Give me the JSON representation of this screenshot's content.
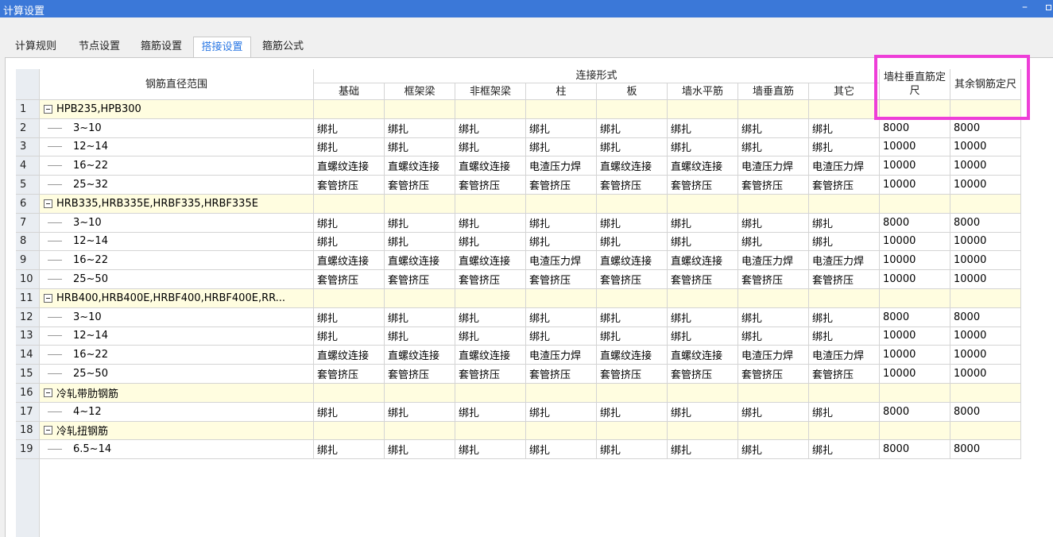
{
  "window": {
    "title": "计算设置",
    "minimize_label": "–"
  },
  "tabs": [
    {
      "label": "计算规则",
      "active": false
    },
    {
      "label": "节点设置",
      "active": false
    },
    {
      "label": "箍筋设置",
      "active": false
    },
    {
      "label": "搭接设置",
      "active": true
    },
    {
      "label": "箍筋公式",
      "active": false
    }
  ],
  "header": {
    "range": "钢筋直径范围",
    "connection_group": "连接形式",
    "connection_cols": [
      "基础",
      "框架梁",
      "非框架梁",
      "柱",
      "板",
      "墙水平筋",
      "墙垂直筋",
      "其它"
    ],
    "wall_col": "墙柱垂直筋定尺",
    "other_col": "其余钢筋定尺"
  },
  "rows": [
    {
      "n": "1",
      "group": true,
      "range": "HPB235,HPB300",
      "c": [],
      "wall": "",
      "other": ""
    },
    {
      "n": "2",
      "group": false,
      "range": "3~10",
      "c": [
        "绑扎",
        "绑扎",
        "绑扎",
        "绑扎",
        "绑扎",
        "绑扎",
        "绑扎",
        "绑扎"
      ],
      "wall": "8000",
      "other": "8000"
    },
    {
      "n": "3",
      "group": false,
      "range": "12~14",
      "c": [
        "绑扎",
        "绑扎",
        "绑扎",
        "绑扎",
        "绑扎",
        "绑扎",
        "绑扎",
        "绑扎"
      ],
      "wall": "10000",
      "other": "10000"
    },
    {
      "n": "4",
      "group": false,
      "range": "16~22",
      "c": [
        "直螺纹连接",
        "直螺纹连接",
        "直螺纹连接",
        "电渣压力焊",
        "直螺纹连接",
        "直螺纹连接",
        "电渣压力焊",
        "电渣压力焊"
      ],
      "wall": "10000",
      "other": "10000"
    },
    {
      "n": "5",
      "group": false,
      "range": "25~32",
      "c": [
        "套管挤压",
        "套管挤压",
        "套管挤压",
        "套管挤压",
        "套管挤压",
        "套管挤压",
        "套管挤压",
        "套管挤压"
      ],
      "wall": "10000",
      "other": "10000"
    },
    {
      "n": "6",
      "group": true,
      "range": "HRB335,HRB335E,HRBF335,HRBF335E",
      "c": [],
      "wall": "",
      "other": ""
    },
    {
      "n": "7",
      "group": false,
      "range": "3~10",
      "c": [
        "绑扎",
        "绑扎",
        "绑扎",
        "绑扎",
        "绑扎",
        "绑扎",
        "绑扎",
        "绑扎"
      ],
      "wall": "8000",
      "other": "8000"
    },
    {
      "n": "8",
      "group": false,
      "range": "12~14",
      "c": [
        "绑扎",
        "绑扎",
        "绑扎",
        "绑扎",
        "绑扎",
        "绑扎",
        "绑扎",
        "绑扎"
      ],
      "wall": "10000",
      "other": "10000"
    },
    {
      "n": "9",
      "group": false,
      "range": "16~22",
      "c": [
        "直螺纹连接",
        "直螺纹连接",
        "直螺纹连接",
        "电渣压力焊",
        "直螺纹连接",
        "直螺纹连接",
        "电渣压力焊",
        "电渣压力焊"
      ],
      "wall": "10000",
      "other": "10000"
    },
    {
      "n": "10",
      "group": false,
      "range": "25~50",
      "c": [
        "套管挤压",
        "套管挤压",
        "套管挤压",
        "套管挤压",
        "套管挤压",
        "套管挤压",
        "套管挤压",
        "套管挤压"
      ],
      "wall": "10000",
      "other": "10000"
    },
    {
      "n": "11",
      "group": true,
      "range": "HRB400,HRB400E,HRBF400,HRBF400E,RR...",
      "c": [],
      "wall": "",
      "other": ""
    },
    {
      "n": "12",
      "group": false,
      "range": "3~10",
      "c": [
        "绑扎",
        "绑扎",
        "绑扎",
        "绑扎",
        "绑扎",
        "绑扎",
        "绑扎",
        "绑扎"
      ],
      "wall": "8000",
      "other": "8000"
    },
    {
      "n": "13",
      "group": false,
      "range": "12~14",
      "c": [
        "绑扎",
        "绑扎",
        "绑扎",
        "绑扎",
        "绑扎",
        "绑扎",
        "绑扎",
        "绑扎"
      ],
      "wall": "10000",
      "other": "10000"
    },
    {
      "n": "14",
      "group": false,
      "range": "16~22",
      "c": [
        "直螺纹连接",
        "直螺纹连接",
        "直螺纹连接",
        "电渣压力焊",
        "直螺纹连接",
        "直螺纹连接",
        "电渣压力焊",
        "电渣压力焊"
      ],
      "wall": "10000",
      "other": "10000"
    },
    {
      "n": "15",
      "group": false,
      "range": "25~50",
      "c": [
        "套管挤压",
        "套管挤压",
        "套管挤压",
        "套管挤压",
        "套管挤压",
        "套管挤压",
        "套管挤压",
        "套管挤压"
      ],
      "wall": "10000",
      "other": "10000"
    },
    {
      "n": "16",
      "group": true,
      "range": "冷轧带肋钢筋",
      "c": [],
      "wall": "",
      "other": ""
    },
    {
      "n": "17",
      "group": false,
      "range": "4~12",
      "c": [
        "绑扎",
        "绑扎",
        "绑扎",
        "绑扎",
        "绑扎",
        "绑扎",
        "绑扎",
        "绑扎"
      ],
      "wall": "8000",
      "other": "8000"
    },
    {
      "n": "18",
      "group": true,
      "range": "冷轧扭钢筋",
      "c": [],
      "wall": "",
      "other": ""
    },
    {
      "n": "19",
      "group": false,
      "range": "6.5~14",
      "c": [
        "绑扎",
        "绑扎",
        "绑扎",
        "绑扎",
        "绑扎",
        "绑扎",
        "绑扎",
        "绑扎"
      ],
      "wall": "8000",
      "other": "8000"
    }
  ],
  "highlight_color": "#ee3ed8",
  "accent_color": "#3b78d8"
}
